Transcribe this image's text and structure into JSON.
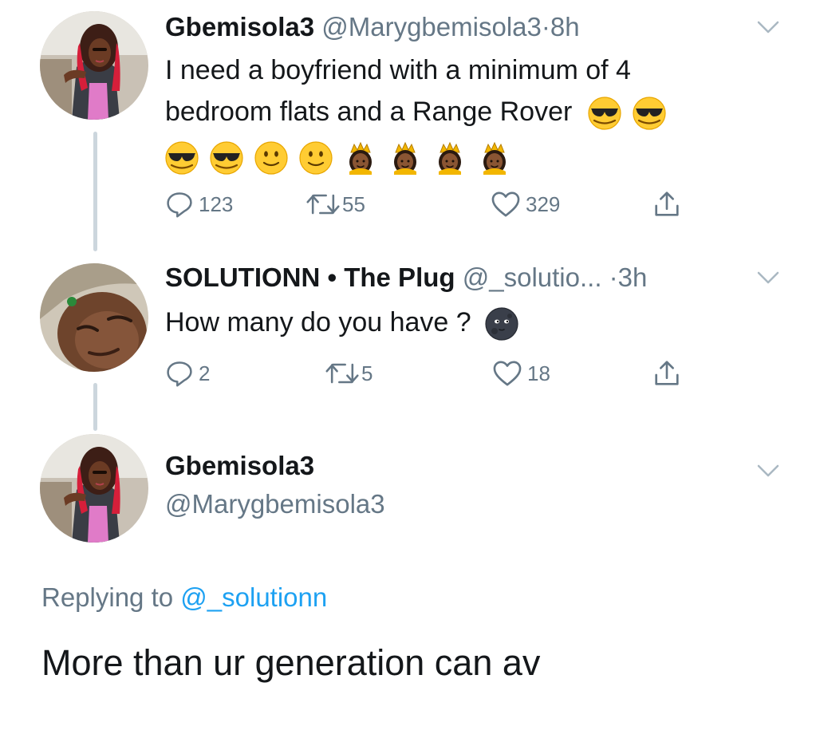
{
  "tweets": [
    {
      "name": "Gbemisola3",
      "handle": "@Marygbemisola3",
      "dot": "·",
      "time": "8h",
      "text_line1": "I need a boyfriend with a minimum of 4",
      "text_line2": "bedroom flats and a Range Rover",
      "emojis_line2": [
        "smiling-face-with-sunglasses",
        "smiling-face-with-sunglasses"
      ],
      "emojis_line3": [
        "smiling-face-with-sunglasses",
        "smiling-face-with-sunglasses",
        "slightly-smiling-face",
        "slightly-smiling-face",
        "princess",
        "princess",
        "princess",
        "princess"
      ],
      "replies": "123",
      "retweets": "55",
      "likes": "329"
    },
    {
      "name": "SOLUTIONN • The Plug",
      "handle": "@_solutio...",
      "dot": "·",
      "time": "3h",
      "text": "How many do you have ?",
      "emojis": [
        "new-moon-face"
      ],
      "replies": "2",
      "retweets": "5",
      "likes": "18"
    }
  ],
  "main_tweet": {
    "name": "Gbemisola3",
    "handle": "@Marygbemisola3",
    "replying_label": "Replying to",
    "replying_mention": "@_solutionn",
    "text": "More than ur generation can av"
  },
  "colors": {
    "text": "#14171a",
    "secondary": "#657786",
    "link": "#1da1f2",
    "thread_line": "#ccd6dd"
  },
  "icons": [
    "chevron-down-icon",
    "reply-icon",
    "retweet-icon",
    "like-icon",
    "share-icon"
  ]
}
